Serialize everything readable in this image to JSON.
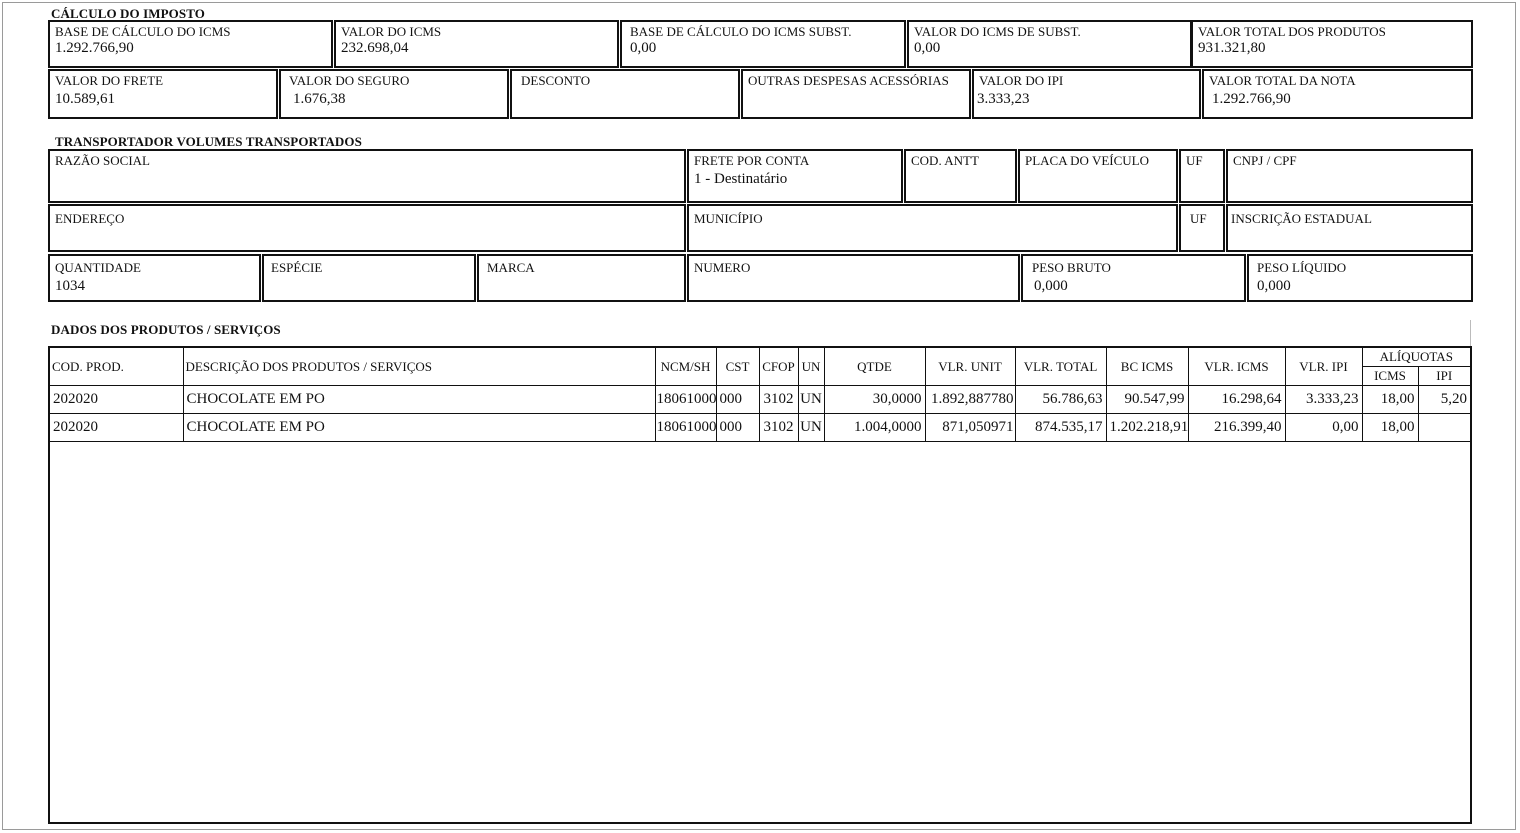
{
  "calculo": {
    "title": "CÁLCULO DO IMPOSTO",
    "row1": [
      {
        "label": "BASE DE CÁLCULO DO ICMS",
        "value": "1.292.766,90"
      },
      {
        "label": "VALOR DO ICMS",
        "value": "232.698,04"
      },
      {
        "label": "BASE DE CÁLCULO DO ICMS SUBST.",
        "value": "0,00"
      },
      {
        "label": "VALOR DO ICMS DE SUBST.",
        "value": "0,00"
      },
      {
        "label": "VALOR TOTAL DOS PRODUTOS",
        "value": "931.321,80"
      }
    ],
    "row2": [
      {
        "label": "VALOR DO FRETE",
        "value": "10.589,61"
      },
      {
        "label": "VALOR DO SEGURO",
        "value": "1.676,38"
      },
      {
        "label": "DESCONTO",
        "value": ""
      },
      {
        "label": "OUTRAS DESPESAS ACESSÓRIAS",
        "value": ""
      },
      {
        "label": "VALOR DO IPI",
        "value": "3.333,23"
      },
      {
        "label": "VALOR TOTAL DA NOTA",
        "value": "1.292.766,90"
      }
    ]
  },
  "transportador": {
    "title": "TRANSPORTADOR VOLUMES TRANSPORTADOS",
    "row1": [
      {
        "label": "RAZÃO SOCIAL",
        "value": ""
      },
      {
        "label": "FRETE POR CONTA",
        "value": "1 - Destinatário"
      },
      {
        "label": "COD. ANTT",
        "value": ""
      },
      {
        "label": "PLACA DO VEÍCULO",
        "value": ""
      },
      {
        "label": "UF",
        "value": ""
      },
      {
        "label": "CNPJ / CPF",
        "value": ""
      }
    ],
    "row2": [
      {
        "label": "ENDEREÇO",
        "value": ""
      },
      {
        "label": "MUNICÍPIO",
        "value": ""
      },
      {
        "label": "UF",
        "value": ""
      },
      {
        "label": "INSCRIÇÃO ESTADUAL",
        "value": ""
      }
    ],
    "row3": [
      {
        "label": "QUANTIDADE",
        "value": "1034"
      },
      {
        "label": "ESPÉCIE",
        "value": ""
      },
      {
        "label": "MARCA",
        "value": ""
      },
      {
        "label": "NUMERO",
        "value": ""
      },
      {
        "label": "PESO BRUTO",
        "value": "0,000"
      },
      {
        "label": "PESO LÍQUIDO",
        "value": "0,000"
      }
    ]
  },
  "produtos": {
    "title": "DADOS DOS PRODUTOS / SERVIÇOS",
    "headers": {
      "cod": "COD. PROD.",
      "desc": "DESCRIÇÃO DOS PRODUTOS / SERVIÇOS",
      "ncm": "NCM/SH",
      "cst": "CST",
      "cfop": "CFOP",
      "un": "UN",
      "qtde": "QTDE",
      "vunit": "VLR. UNIT",
      "vtotal": "VLR. TOTAL",
      "bcicms": "BC ICMS",
      "vicms": "VLR. ICMS",
      "vipi": "VLR. IPI",
      "aliquotas": "ALÍQUOTAS",
      "aliq_icms": "ICMS",
      "aliq_ipi": "IPI"
    },
    "rows": [
      {
        "cod": "202020",
        "desc": "CHOCOLATE EM PO",
        "ncm": "18061000",
        "cst": "000",
        "cfop": "3102",
        "un": "UN",
        "qtde": "30,0000",
        "vunit": "1.892,887780",
        "vtotal": "56.786,63",
        "bcicms": "90.547,99",
        "vicms": "16.298,64",
        "vipi": "3.333,23",
        "aliq_icms": "18,00",
        "aliq_ipi": "5,20"
      },
      {
        "cod": "202020",
        "desc": "CHOCOLATE EM PO",
        "ncm": "18061000",
        "cst": "000",
        "cfop": "3102",
        "un": "UN",
        "qtde": "1.004,0000",
        "vunit": "871,050971",
        "vtotal": "874.535,17",
        "bcicms": "1.202.218,91",
        "vicms": "216.399,40",
        "vipi": "0,00",
        "aliq_icms": "18,00",
        "aliq_ipi": ""
      }
    ]
  }
}
